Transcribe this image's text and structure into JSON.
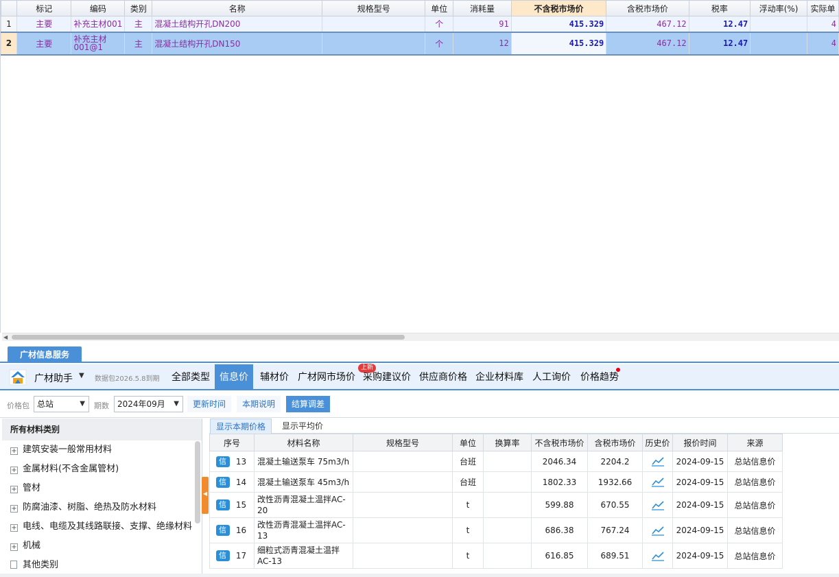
{
  "grid": {
    "headers": [
      "",
      "标记",
      "编码",
      "类别",
      "名称",
      "规格型号",
      "单位",
      "消耗量",
      "不含税市场价",
      "含税市场价",
      "税率",
      "浮动率(%)",
      "实际单"
    ],
    "rows": [
      {
        "idx": "1",
        "mark": "主要",
        "code": "补充主材001",
        "code_line2": "",
        "category": "主",
        "name": "混凝土结构开孔DN200",
        "spec": "",
        "unit": "个",
        "qty": "91",
        "price_ex": "415.329",
        "price_inc": "467.12",
        "tax": "12.47",
        "float": "",
        "actual": "4"
      },
      {
        "idx": "2",
        "mark": "主要",
        "code": "补充主材",
        "code_line2": "001@1",
        "category": "主",
        "name": "混凝土结构开孔DN150",
        "spec": "",
        "unit": "个",
        "qty": "12",
        "price_ex": "415.329",
        "price_inc": "467.12",
        "tax": "12.47",
        "float": "",
        "actual": "4"
      }
    ]
  },
  "service": {
    "tab_label": "广材信息服务",
    "brand": "广材助手",
    "package_note": "数据包2026.5.8到期",
    "nav": [
      "全部类型",
      "信息价",
      "辅材价",
      "广材网市场价",
      "采购建议价",
      "供应商价格",
      "企业材料库",
      "人工询价",
      "价格趋势"
    ],
    "new_badge": "上新"
  },
  "filters": {
    "pkg_label": "价格包",
    "pkg_value": "总站",
    "period_label": "期数",
    "period_value": "2024年09月",
    "btn_update": "更新时间",
    "btn_notes": "本期说明",
    "btn_settle": "结算调差"
  },
  "categories": {
    "title": "所有材料类别",
    "items": [
      "建筑安装一般常用材料",
      "金属材料(不含金属管材)",
      "管材",
      "防腐油漆、树脂、绝热及防水材料",
      "电线、电缆及其线路联接、支撑、绝缘材料",
      "机械",
      "其他类别"
    ]
  },
  "list": {
    "subtabs": [
      "显示本期价格",
      "显示平均价"
    ],
    "headers": [
      "序号",
      "材料名称",
      "规格型号",
      "单位",
      "换算率",
      "不含税市场价",
      "含税市场价",
      "历史价",
      "报价时间",
      "来源"
    ],
    "xin_label": "信",
    "rows": [
      {
        "seq": "13",
        "name": "混凝土输送泵车 75m3/h",
        "spec": "",
        "unit": "台班",
        "rate": "",
        "price_ex": "2046.34",
        "price_inc": "2204.2",
        "date": "2024-09-15",
        "source": "总站信息价"
      },
      {
        "seq": "14",
        "name": "混凝土输送泵车 45m3/h",
        "spec": "",
        "unit": "台班",
        "rate": "",
        "price_ex": "1802.33",
        "price_inc": "1932.66",
        "date": "2024-09-15",
        "source": "总站信息价"
      },
      {
        "seq": "15",
        "name": "改性沥青混凝土温拌AC-20",
        "spec": "",
        "unit": "t",
        "rate": "",
        "price_ex": "599.88",
        "price_inc": "670.55",
        "date": "2024-09-15",
        "source": "总站信息价"
      },
      {
        "seq": "16",
        "name": "改性沥青混凝土温拌AC-13",
        "spec": "",
        "unit": "t",
        "rate": "",
        "price_ex": "686.38",
        "price_inc": "767.24",
        "date": "2024-09-15",
        "source": "总站信息价"
      },
      {
        "seq": "17",
        "name": "细粒式沥青混凝土温拌AC-13",
        "spec": "",
        "unit": "t",
        "rate": "",
        "price_ex": "616.85",
        "price_inc": "689.51",
        "date": "2024-09-15",
        "source": "总站信息价"
      }
    ]
  },
  "colors": {
    "accent": "#4a90d9",
    "purple_text": "#8b2c9e",
    "selected_row": "#a9ccf5",
    "badge": "#e23b3b"
  }
}
